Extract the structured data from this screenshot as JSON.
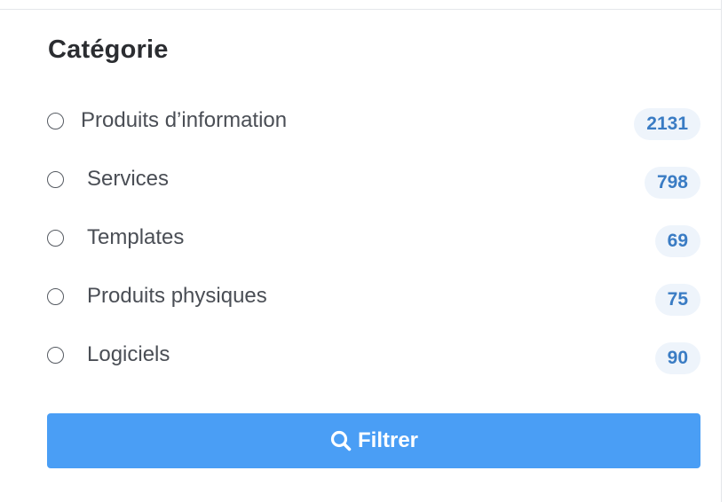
{
  "filter": {
    "title": "Catégorie",
    "options": [
      {
        "label": "Produits d’information",
        "count": "2131"
      },
      {
        "label": "Services",
        "count": "798"
      },
      {
        "label": "Templates",
        "count": "69"
      },
      {
        "label": "Produits physiques",
        "count": "75"
      },
      {
        "label": "Logiciels",
        "count": "90"
      }
    ],
    "button_label": "Filtrer",
    "button_icon": "search-icon"
  },
  "colors": {
    "accent": "#4a9ef5",
    "count_text": "#3a7cc4",
    "count_bg": "#eef4fb",
    "title": "#2b2d31",
    "label": "#4a4e55"
  }
}
